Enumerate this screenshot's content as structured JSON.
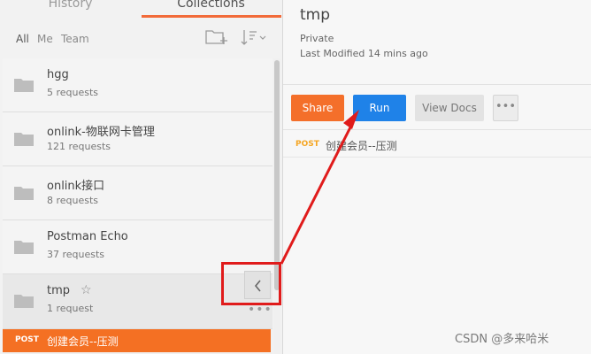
{
  "sidebar": {
    "tabs": [
      {
        "label": "History"
      },
      {
        "label": "Collections"
      }
    ],
    "filters": [
      {
        "label": "All"
      },
      {
        "label": "Me"
      },
      {
        "label": "Team"
      }
    ],
    "collections": [
      {
        "name": "hgg",
        "count": "5 requests",
        "icon": "folder-icon"
      },
      {
        "name": "onlink-物联网卡管理",
        "count": "121 requests",
        "icon": "folder-icon"
      },
      {
        "name": "onlink接口",
        "count": "8 requests",
        "icon": "folder-icon"
      },
      {
        "name": "Postman Echo",
        "count": "37 requests",
        "icon": "folder-icon"
      },
      {
        "name": "tmp",
        "count": "1 request",
        "icon": "folder-icon",
        "starred": "☆"
      }
    ],
    "request": {
      "method": "POST",
      "name": "创建会员--压测"
    },
    "more": "•••"
  },
  "detail": {
    "title": "tmp",
    "visibility": "Private",
    "modified": "Last Modified 14 mins ago",
    "buttons": {
      "share": "Share",
      "run": "Run",
      "view_docs": "View Docs",
      "more": "•••"
    },
    "request": {
      "method": "POST",
      "name": "创建会员--压测"
    }
  },
  "watermark": "CSDN @多来哈米",
  "colors": {
    "accent_orange": "#f46f2a",
    "run_blue": "#1f82e8",
    "annotation_red": "#e01b1b",
    "post_orange": "#f5a623"
  }
}
